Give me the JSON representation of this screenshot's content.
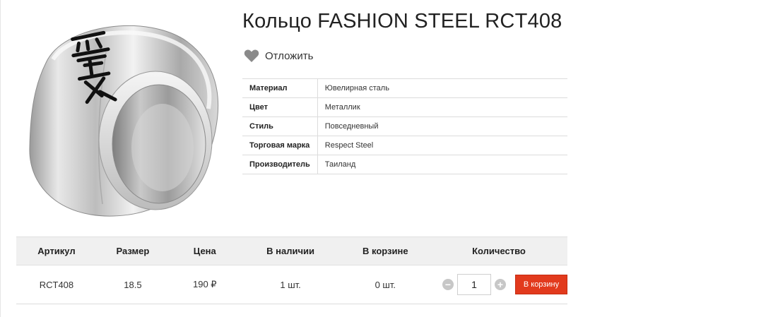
{
  "product": {
    "title": "Кольцо FASHION STEEL RCT408",
    "image_alt": "ring-image"
  },
  "wishlist": {
    "label": "Отложить",
    "icon": "heart-icon"
  },
  "specs": [
    {
      "key": "Материал",
      "value": "Ювелирная сталь"
    },
    {
      "key": "Цвет",
      "value": "Металлик"
    },
    {
      "key": "Стиль",
      "value": "Повседневный"
    },
    {
      "key": "Торговая марка",
      "value": "Respect Steel"
    },
    {
      "key": "Производитель",
      "value": "Таиланд"
    }
  ],
  "order": {
    "headers": {
      "sku": "Артикул",
      "size": "Размер",
      "price": "Цена",
      "in_stock": "В наличии",
      "in_cart": "В корзине",
      "quantity": "Количество"
    },
    "row": {
      "sku": "RCT408",
      "size": "18.5",
      "price": "190 ₽",
      "in_stock": "1 шт.",
      "in_cart": "0 шт.",
      "quantity": "1"
    },
    "decrement_symbol": "−",
    "increment_symbol": "+",
    "add_to_cart_label": "В корзину"
  },
  "colors": {
    "cart_button": "#e23a1d",
    "wishlist_heart": "#8a8a8a",
    "stepper": "#c7c7c7"
  }
}
